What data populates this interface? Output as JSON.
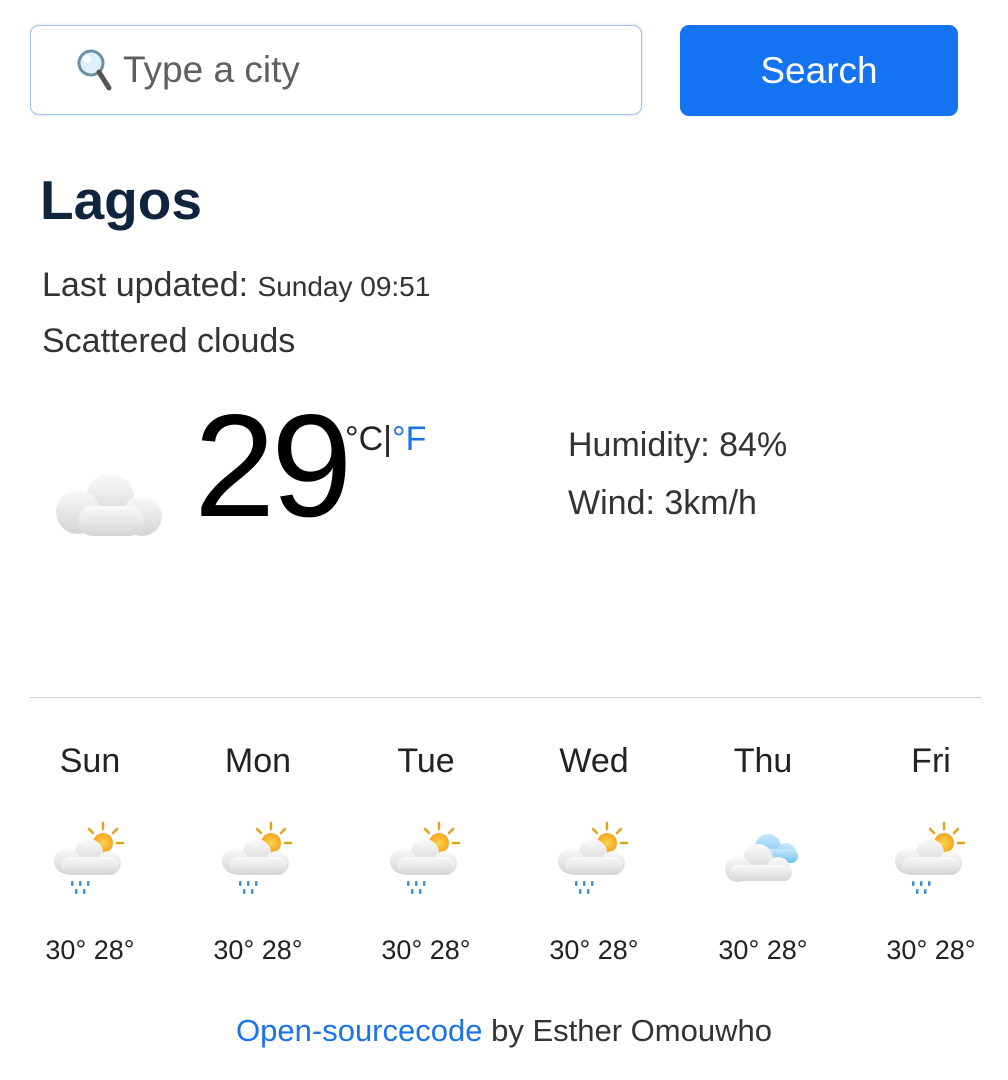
{
  "search": {
    "placeholder": "Type a city",
    "value": "",
    "button_label": "Search"
  },
  "weather": {
    "city": "Lagos",
    "last_updated_label": "Last updated:",
    "last_updated_time": "Sunday 09:51",
    "description": "Scattered clouds",
    "icon": "cloud-icon",
    "temperature": "29",
    "unit_celsius": "°C",
    "unit_separator": "|",
    "unit_fahrenheit": "°F",
    "humidity": "Humidity: 84%",
    "wind": "Wind: 3km/h"
  },
  "forecast": [
    {
      "day": "Sun",
      "icon": "sun-cloud-rain-icon",
      "temps": "30° 28°"
    },
    {
      "day": "Mon",
      "icon": "sun-cloud-rain-icon",
      "temps": "30° 28°"
    },
    {
      "day": "Tue",
      "icon": "sun-cloud-rain-icon",
      "temps": "30° 28°"
    },
    {
      "day": "Wed",
      "icon": "sun-cloud-rain-icon",
      "temps": "30° 28°"
    },
    {
      "day": "Thu",
      "icon": "cloudy-icon",
      "temps": "30° 28°"
    },
    {
      "day": "Fri",
      "icon": "sun-cloud-rain-icon",
      "temps": "30° 28°"
    }
  ],
  "footer": {
    "link_text": "Open-sourcecode",
    "suffix": " by Esther Omouwho"
  },
  "colors": {
    "accent": "#1473f0",
    "link": "#1a73e8",
    "city": "#11243e"
  }
}
